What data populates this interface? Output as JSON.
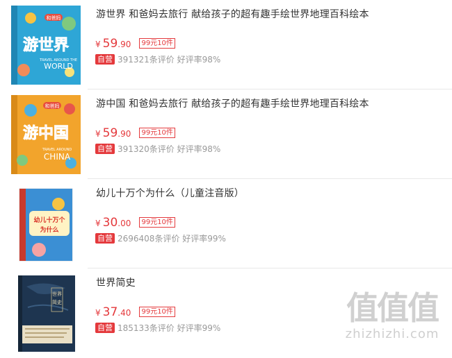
{
  "products": [
    {
      "title": "游世界 和爸妈去旅行 献给孩子的超有趣手绘世界地理百科绘本",
      "currency": "¥",
      "price_int": "59",
      "price_dec": ".90",
      "promo": "99元10件",
      "badge": "自营",
      "reviews": "391321条评价",
      "rating": "好评率98%",
      "cover": {
        "main_text": "游世界",
        "tag_text": "和爸妈",
        "sub_text": "TRAVEL AROUND THE",
        "en_text": "WORLD",
        "color": "#2ea6d6"
      }
    },
    {
      "title": "游中国 和爸妈去旅行 献给孩子的超有趣手绘世界地理百科绘本",
      "currency": "¥",
      "price_int": "59",
      "price_dec": ".90",
      "promo": "99元10件",
      "badge": "自营",
      "reviews": "391320条评价",
      "rating": "好评率98%",
      "cover": {
        "main_text": "游中国",
        "tag_text": "和爸妈",
        "sub_text": "TRAVEL AROUND",
        "en_text": "CHINA",
        "color": "#f2a42c"
      }
    },
    {
      "title": "幼儿十万个为什么（儿童注音版）",
      "currency": "¥",
      "price_int": "30",
      "price_dec": ".00",
      "promo": "99元10件",
      "badge": "自营",
      "reviews": "2696408条评价",
      "rating": "好评率99%",
      "cover": {
        "main_text": "幼儿十万个为什么",
        "color": "#3b8fd4"
      }
    },
    {
      "title": "世界简史",
      "currency": "¥",
      "price_int": "37",
      "price_dec": ".40",
      "promo": "99元10件",
      "badge": "自营",
      "reviews": "185133条评价",
      "rating": "好评率99%",
      "cover": {
        "main_text": "世界简史",
        "color": "#1e3550"
      }
    }
  ],
  "watermark": {
    "logo": "值值值",
    "text": "zhizhizhi.com"
  },
  "colors": {
    "accent": "#e4393c",
    "meta": "#999999",
    "title": "#333333"
  }
}
